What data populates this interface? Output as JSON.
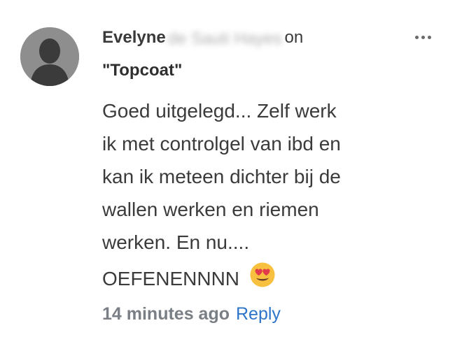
{
  "comment": {
    "author_name": "Evelyne",
    "author_surname_obscured": "de Sauti Hayes",
    "connector": "on",
    "post_title": "Topcoat",
    "body_lines": [
      "Goed uitgelegd... Zelf werk",
      "ik met controlgel van ibd en",
      "kan ik meteen dichter bij de",
      "wallen werken en riemen",
      "werken. En nu....",
      "OEFENENNNN"
    ],
    "emoji_icon": "heart-eyes-emoji-icon",
    "timestamp": "14 minutes ago",
    "reply_label": "Reply"
  },
  "colors": {
    "reply_link": "#2d75c9",
    "timestamp": "#7a7f86",
    "avatar_background": "#8e8e8e"
  }
}
